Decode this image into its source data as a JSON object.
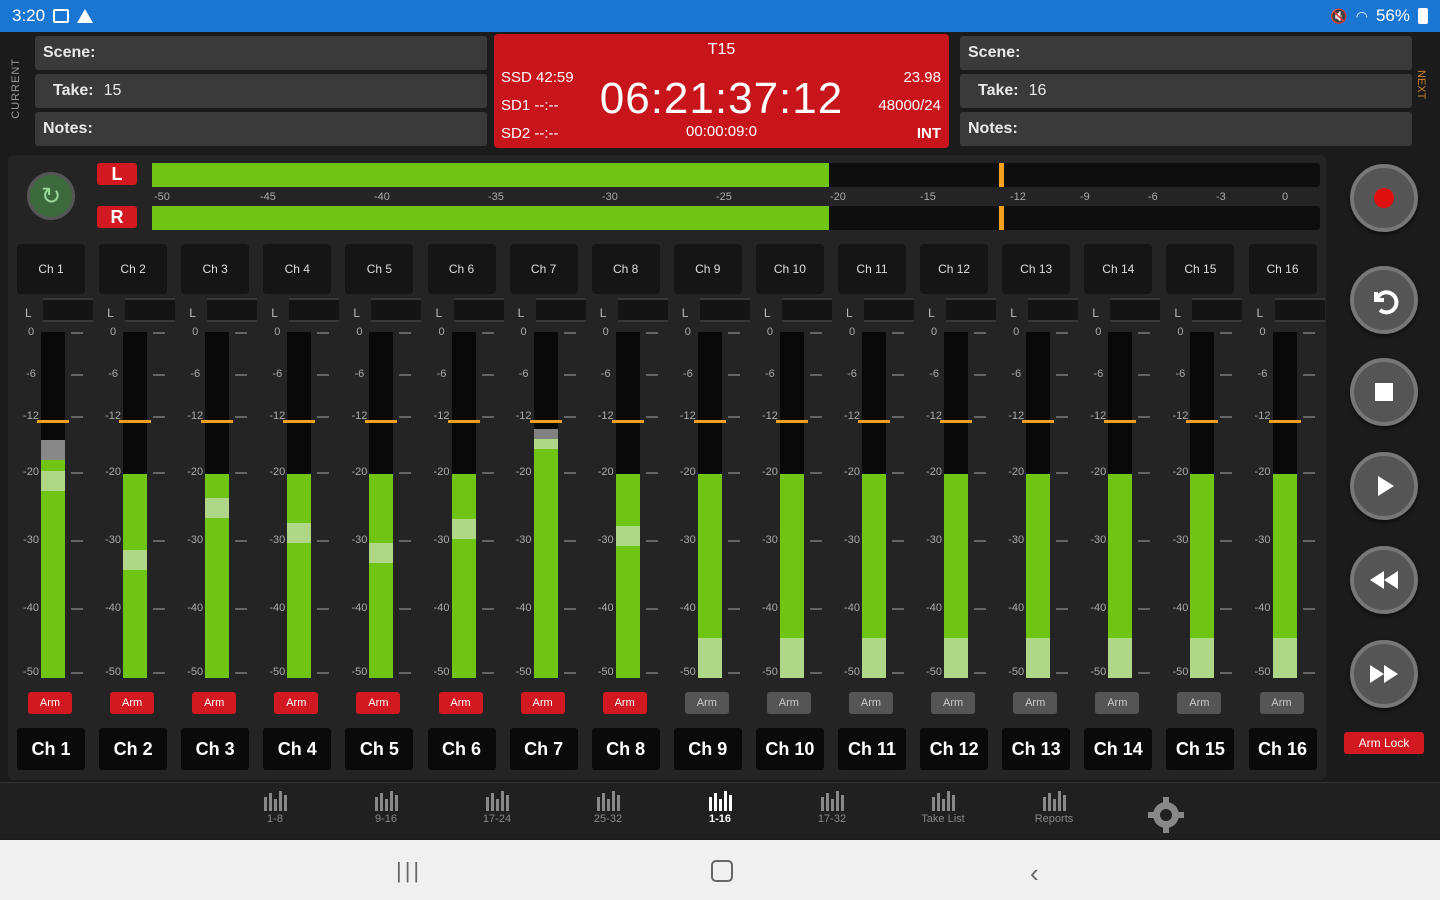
{
  "status_bar": {
    "time": "3:20",
    "battery": "56%"
  },
  "current": {
    "label": "CURRENT",
    "scene_label": "Scene:",
    "scene_value": "",
    "take_label": "Take:",
    "take_value": "15",
    "notes_label": "Notes:",
    "notes_value": ""
  },
  "next": {
    "label": "NEXT",
    "scene_label": "Scene:",
    "scene_value": "",
    "take_label": "Take:",
    "take_value": "16",
    "notes_label": "Notes:",
    "notes_value": ""
  },
  "timecode": {
    "take": "T15",
    "main": "06:21:37:12",
    "elapsed": "00:00:09:0",
    "ssd": "SSD 42:59",
    "sd1": "SD1 --:--",
    "sd2": "SD2 --:--",
    "fps": "23.98",
    "rate": "48000/24",
    "source": "INT"
  },
  "master": {
    "left_label": "L",
    "right_label": "R",
    "left_level": 0.58,
    "right_level": 0.58,
    "peak": 0.725,
    "scale": [
      "-50",
      "-45",
      "-40",
      "-35",
      "-30",
      "-25",
      "-20",
      "-15",
      "-12",
      "-9",
      "-6",
      "-3",
      "0"
    ]
  },
  "channel_scale": [
    "0",
    "-6",
    "-12",
    "-20",
    "-30",
    "-40",
    "-50"
  ],
  "channels": [
    {
      "top": "Ch 1",
      "name": "Ch 1",
      "mini": "L",
      "level": 0.63,
      "fader": 0.57,
      "fader2": 0.63,
      "arm": "Arm",
      "armed": true
    },
    {
      "top": "Ch 2",
      "name": "Ch 2",
      "mini": "L",
      "level": 0.59,
      "fader": 0.34,
      "fader2": null,
      "arm": "Arm",
      "armed": true
    },
    {
      "top": "Ch 3",
      "name": "Ch 3",
      "mini": "L",
      "level": 0.59,
      "fader": 0.49,
      "fader2": null,
      "arm": "Arm",
      "armed": true
    },
    {
      "top": "Ch 4",
      "name": "Ch 4",
      "mini": "L",
      "level": 0.59,
      "fader": 0.42,
      "fader2": null,
      "arm": "Arm",
      "armed": true
    },
    {
      "top": "Ch 5",
      "name": "Ch 5",
      "mini": "L",
      "level": 0.59,
      "fader": 0.36,
      "fader2": null,
      "arm": "Arm",
      "armed": true
    },
    {
      "top": "Ch 6",
      "name": "Ch 6",
      "mini": "L",
      "level": 0.59,
      "fader": 0.43,
      "fader2": null,
      "arm": "Arm",
      "armed": true
    },
    {
      "top": "Ch 7",
      "name": "Ch 7",
      "mini": "L",
      "level": 0.69,
      "fader": 0.69,
      "fader2": null,
      "arm": "Arm",
      "armed": true
    },
    {
      "top": "Ch 8",
      "name": "Ch 8",
      "mini": "L",
      "level": 0.59,
      "fader": 0.41,
      "fader2": null,
      "arm": "Arm",
      "armed": true
    },
    {
      "top": "Ch 9",
      "name": "Ch 9",
      "mini": "L",
      "level": 0.59,
      "fader": 0.0,
      "fader2": null,
      "arm": "Arm",
      "armed": false
    },
    {
      "top": "Ch 10",
      "name": "Ch 10",
      "mini": "L",
      "level": 0.59,
      "fader": 0.0,
      "fader2": null,
      "arm": "Arm",
      "armed": false
    },
    {
      "top": "Ch 11",
      "name": "Ch 11",
      "mini": "L",
      "level": 0.59,
      "fader": 0.0,
      "fader2": null,
      "arm": "Arm",
      "armed": false
    },
    {
      "top": "Ch 12",
      "name": "Ch 12",
      "mini": "L",
      "level": 0.59,
      "fader": 0.0,
      "fader2": null,
      "arm": "Arm",
      "armed": false
    },
    {
      "top": "Ch 13",
      "name": "Ch 13",
      "mini": "L",
      "level": 0.59,
      "fader": 0.0,
      "fader2": null,
      "arm": "Arm",
      "armed": false
    },
    {
      "top": "Ch 14",
      "name": "Ch 14",
      "mini": "L",
      "level": 0.59,
      "fader": 0.0,
      "fader2": null,
      "arm": "Arm",
      "armed": false
    },
    {
      "top": "Ch 15",
      "name": "Ch 15",
      "mini": "L",
      "level": 0.59,
      "fader": 0.0,
      "fader2": null,
      "arm": "Arm",
      "armed": false
    },
    {
      "top": "Ch 16",
      "name": "Ch 16",
      "mini": "L",
      "level": 0.59,
      "fader": 0.0,
      "fader2": null,
      "arm": "Arm",
      "armed": false
    }
  ],
  "transport": {
    "record": "record-icon",
    "undo": "undo-icon",
    "stop": "stop-icon",
    "play": "play-icon",
    "rewind": "rewind-icon",
    "forward": "fast-forward-icon",
    "arm_lock": "Arm Lock"
  },
  "nav": [
    {
      "label": "1-8",
      "active": false
    },
    {
      "label": "9-16",
      "active": false
    },
    {
      "label": "17-24",
      "active": false
    },
    {
      "label": "25-32",
      "active": false
    },
    {
      "label": "1-16",
      "active": true
    },
    {
      "label": "17-32",
      "active": false
    },
    {
      "label": "Take List",
      "active": false
    },
    {
      "label": "Reports",
      "active": false
    }
  ],
  "colors": {
    "accent_red": "#d21820",
    "meter_green": "#6fc414",
    "peak_orange": "#f4a11d",
    "statusbar_blue": "#1976d2"
  }
}
